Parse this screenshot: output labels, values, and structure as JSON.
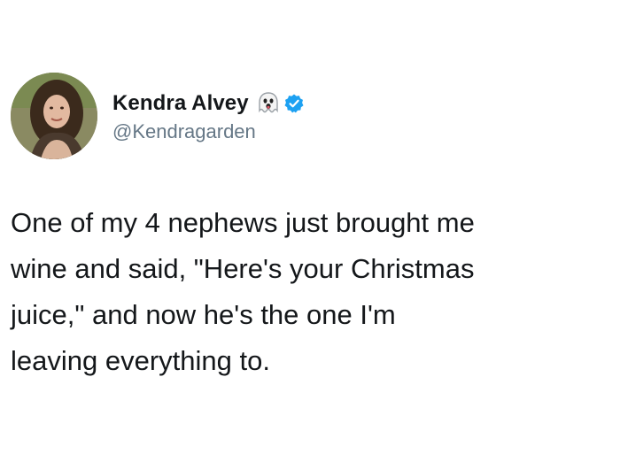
{
  "author": {
    "display_name": "Kendra Alvey",
    "handle": "@Kendragarden",
    "badges": [
      "ghost-emoji",
      "verified-badge"
    ]
  },
  "tweet": {
    "lines": [
      "One of my 4 nephews just brought me",
      "wine and said, \"Here's your Christmas",
      "juice,\" and now he's the one I'm",
      "leaving everything to."
    ]
  },
  "colors": {
    "text": "#14171a",
    "handle": "#657786",
    "verified": "#1da1f2",
    "background": "#ffffff"
  }
}
